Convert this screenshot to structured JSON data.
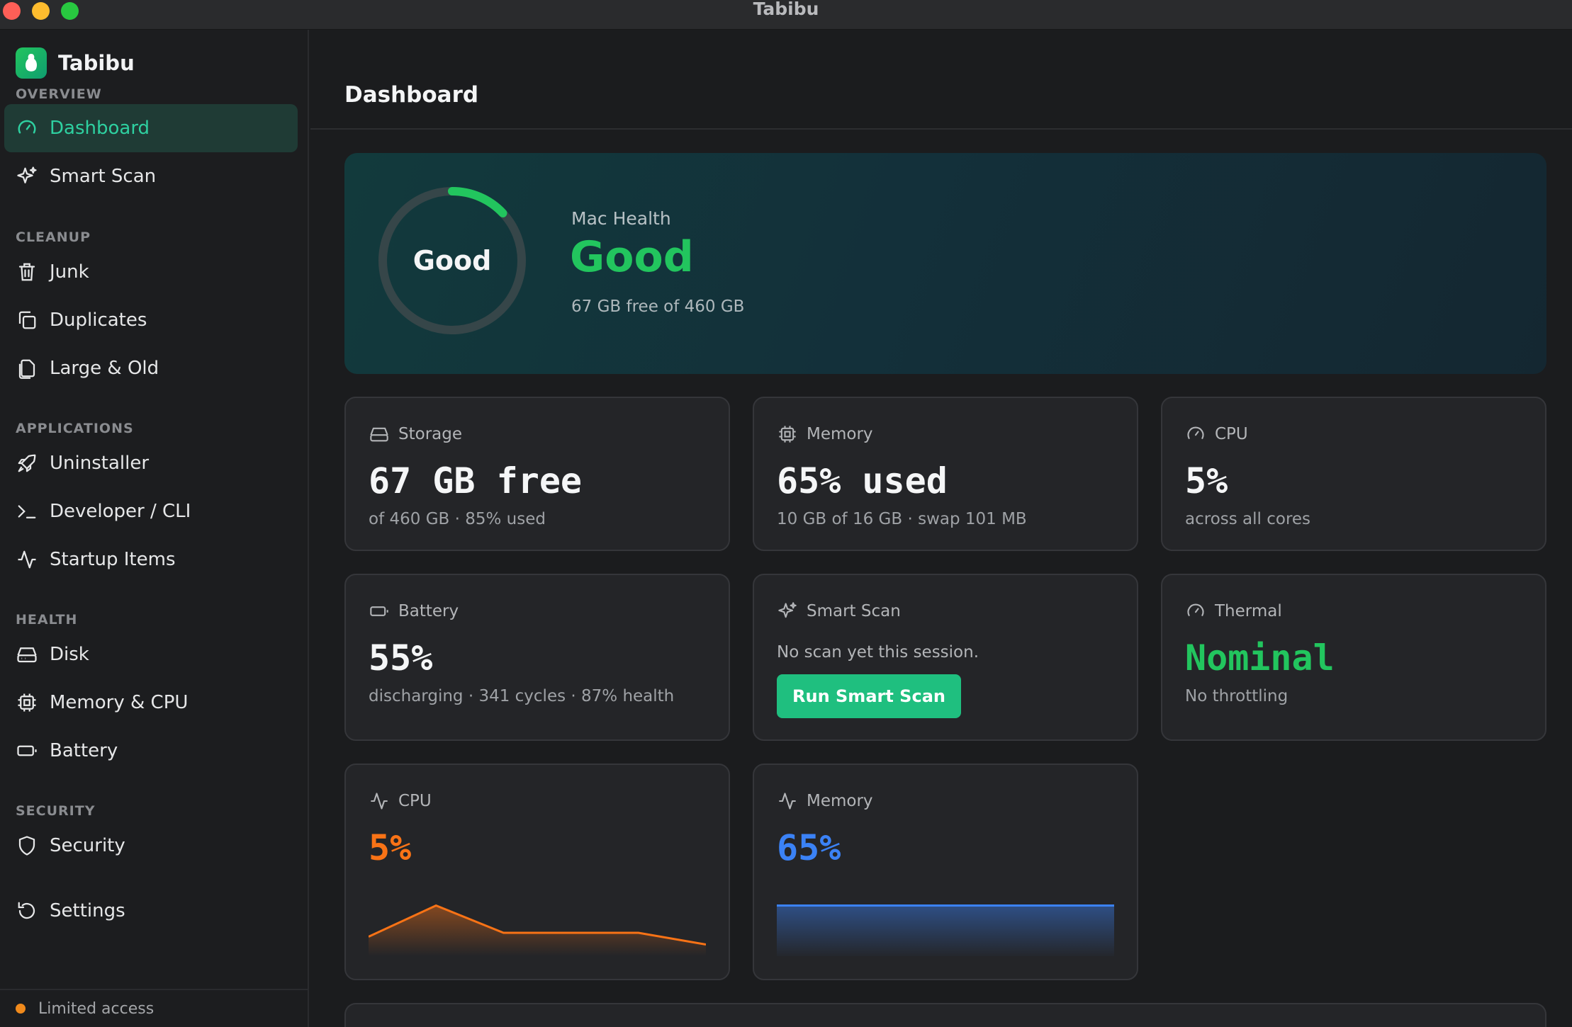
{
  "window": {
    "title": "Tabibu"
  },
  "sidebar": {
    "brand": "Tabibu",
    "sections": {
      "overview": "OVERVIEW",
      "cleanup": "CLEANUP",
      "applications": "APPLICATIONS",
      "health": "HEALTH",
      "security": "SECURITY"
    },
    "items": {
      "dashboard": "Dashboard",
      "smart_scan": "Smart Scan",
      "junk": "Junk",
      "duplicates": "Duplicates",
      "large_old": "Large & Old",
      "uninstaller": "Uninstaller",
      "developer_cli": "Developer / CLI",
      "startup_items": "Startup Items",
      "disk": "Disk",
      "memory_cpu": "Memory & CPU",
      "battery": "Battery",
      "security": "Security",
      "settings": "Settings"
    },
    "active_item": "Dashboard",
    "footer_status": "Limited access"
  },
  "header": {
    "title": "Dashboard"
  },
  "hero": {
    "gauge_label": "Good",
    "gauge_level": 0.13,
    "label": "Mac Health",
    "status": "Good",
    "detail": "67 GB free of 460 GB"
  },
  "cards": {
    "storage": {
      "label": "Storage",
      "value": "67 GB free",
      "sub": "of 460 GB · 85% used"
    },
    "memory": {
      "label": "Memory",
      "value": "65% used",
      "sub": "10 GB of 16 GB · swap 101 MB"
    },
    "cpu": {
      "label": "CPU",
      "value": "5%",
      "sub": "across all cores"
    },
    "battery": {
      "label": "Battery",
      "value": "55%",
      "sub": "discharging · 341 cycles · 87% health"
    },
    "smart_scan": {
      "label": "Smart Scan",
      "note": "No scan yet this session.",
      "button": "Run Smart Scan"
    },
    "thermal": {
      "label": "Thermal",
      "value": "Nominal",
      "sub": "No throttling"
    }
  },
  "charts": {
    "cpu": {
      "label": "CPU",
      "value": "5%",
      "color": "#f97316"
    },
    "memory": {
      "label": "Memory",
      "value": "65%",
      "color": "#3b82f6"
    }
  },
  "chart_data": [
    {
      "type": "area",
      "title": "CPU",
      "series": [
        {
          "name": "CPU",
          "values": [
            5,
            13,
            6,
            6,
            6,
            3
          ]
        }
      ],
      "ylim": [
        0,
        20
      ]
    },
    {
      "type": "area",
      "title": "Memory",
      "series": [
        {
          "name": "Memory",
          "values": [
            65,
            65,
            65,
            65,
            65,
            65
          ]
        }
      ],
      "ylim": [
        0,
        100
      ]
    }
  ],
  "colors": {
    "accent": "#22c55e",
    "active_nav_text": "#2ed0a0",
    "button": "#1fbf7f",
    "status_dot": "#f08a1c"
  }
}
